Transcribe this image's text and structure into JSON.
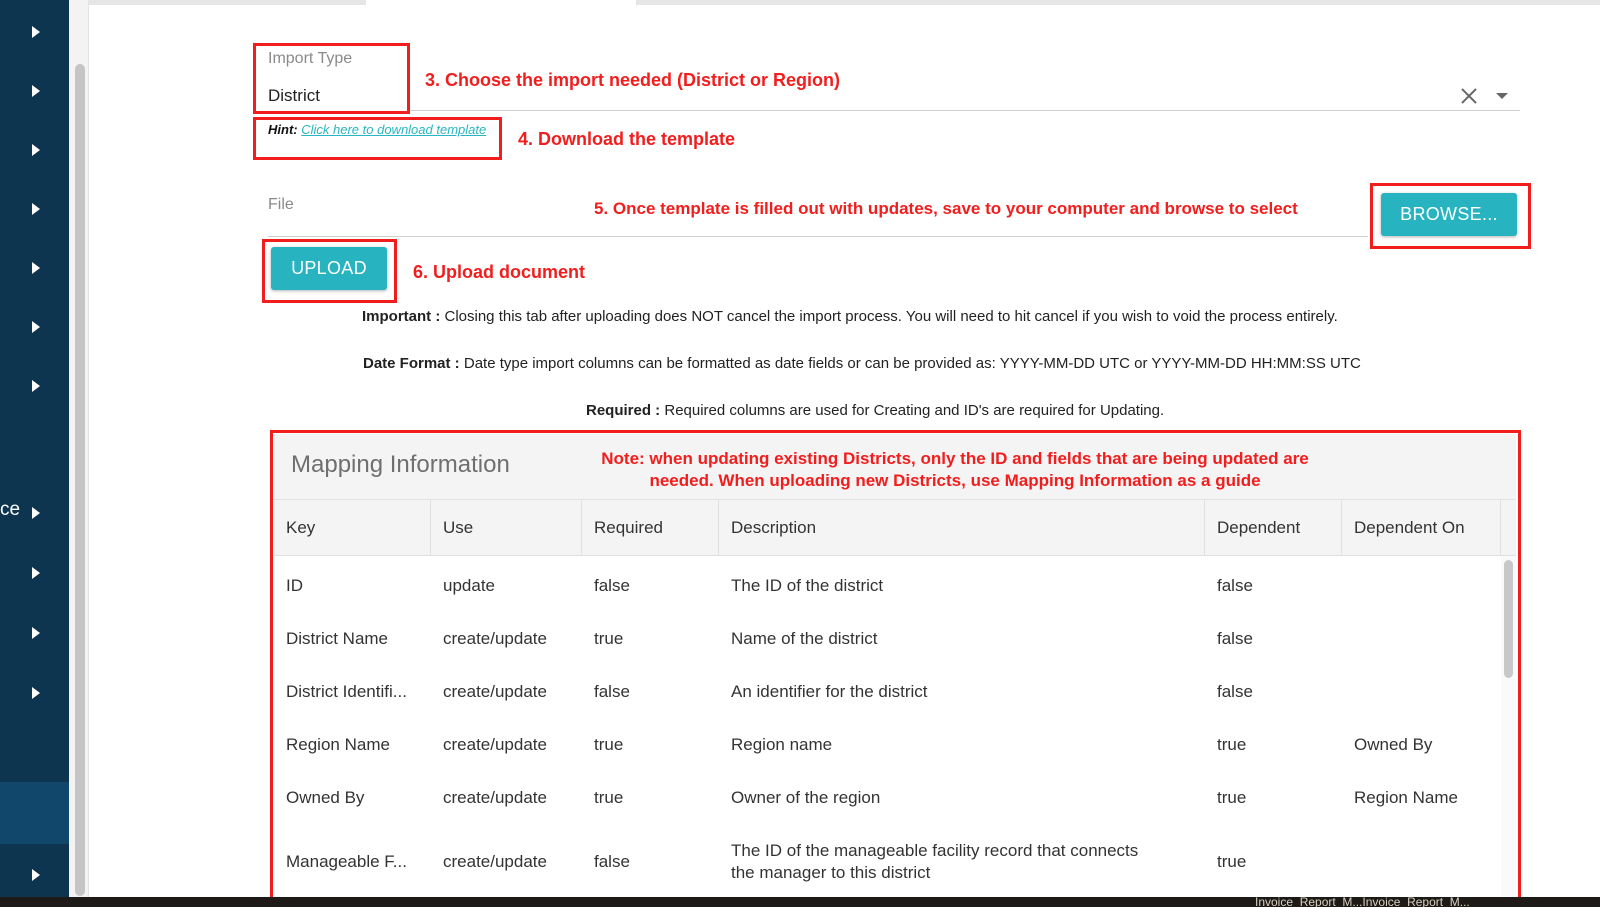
{
  "sidebar": {
    "items": [
      {
        "icon": "chevron-right-icon"
      },
      {
        "icon": "chevron-right-icon"
      },
      {
        "icon": "chevron-right-icon"
      },
      {
        "icon": "chevron-right-icon"
      },
      {
        "icon": "chevron-right-icon"
      },
      {
        "icon": "chevron-right-icon"
      },
      {
        "icon": "chevron-right-icon"
      },
      {
        "icon": "chevron-right-icon"
      },
      {
        "icon": "chevron-right-icon"
      },
      {
        "icon": "chevron-right-icon"
      },
      {
        "icon": "chevron-right-icon"
      },
      {
        "icon": "chevron-right-icon"
      }
    ],
    "partial_label": "ce"
  },
  "import_type": {
    "label": "Import Type",
    "value": "District"
  },
  "hint": {
    "label": "Hint:",
    "link_text": "Click here to download template"
  },
  "file": {
    "label": "File",
    "browse_label": "BROWSE...",
    "upload_label": "UPLOAD"
  },
  "annotations": {
    "step3": "3. Choose the import needed (District or Region)",
    "step4": "4. Download the template",
    "step5": "5. Once template is filled out with updates, save to your computer and browse to select",
    "step6": "6. Upload document",
    "note_line1": "Note: when updating existing Districts, only the ID and fields that are being updated are",
    "note_line2": "needed. When uploading new Districts, use Mapping Information as a guide"
  },
  "info": {
    "important_label": "Important :",
    "important_text": " Closing this tab after uploading does NOT cancel the import process. You will need to hit cancel if you wish to void the process entirely.",
    "date_label": "Date Format :",
    "date_text": " Date type import columns can be formatted as date fields or can be provided as: YYYY-MM-DD UTC or YYYY-MM-DD HH:MM:SS UTC",
    "required_label": "Required :",
    "required_text": " Required columns are used for Creating and ID's are required for Updating."
  },
  "mapping": {
    "title": "Mapping Information",
    "columns": [
      "Key",
      "Use",
      "Required",
      "Description",
      "Dependent",
      "Dependent On"
    ],
    "rows": [
      [
        "ID",
        "update",
        "false",
        "The ID of the district",
        "false",
        ""
      ],
      [
        "District Name",
        "create/update",
        "true",
        "Name of the district",
        "false",
        ""
      ],
      [
        "District Identifi...",
        "create/update",
        "false",
        "An identifier for the district",
        "false",
        ""
      ],
      [
        "Region Name",
        "create/update",
        "true",
        "Region name",
        "true",
        "Owned By"
      ],
      [
        "Owned By",
        "create/update",
        "true",
        "Owner of the region",
        "true",
        "Region Name"
      ],
      [
        "Manageable F...",
        "create/update",
        "false",
        "The ID of the manageable facility record that connects the manager to this district",
        "true",
        ""
      ]
    ]
  },
  "taskbar": {
    "partial_text": "Invoice_Report_M...Invoice_Report_M..."
  },
  "colors": {
    "sidebar": "#0d3550",
    "accent": "#27b3c0",
    "annotation": "#f21d1d"
  }
}
